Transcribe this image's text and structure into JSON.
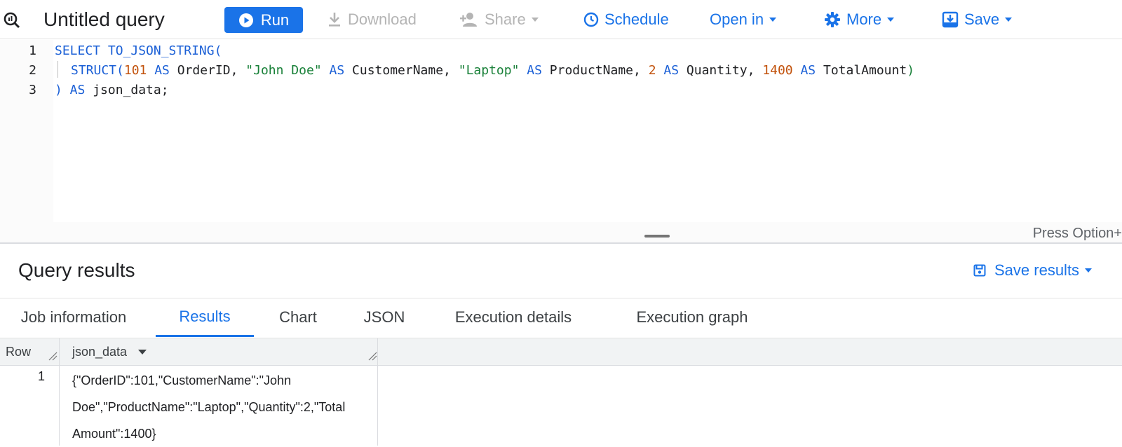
{
  "toolbar": {
    "title": "Untitled query",
    "run_label": "Run",
    "download_label": "Download",
    "share_label": "Share",
    "schedule_label": "Schedule",
    "open_in_label": "Open in",
    "more_label": "More",
    "save_label": "Save"
  },
  "editor": {
    "line_numbers": [
      "1",
      "2",
      "3"
    ],
    "lines": [
      [
        {
          "t": "SELECT TO_JSON_STRING(",
          "c": "kw"
        }
      ],
      [
        {
          "t": "STRUCT(",
          "c": "kw"
        },
        {
          "t": "101",
          "c": "num"
        },
        {
          "t": " AS ",
          "c": "kw"
        },
        {
          "t": "OrderID, ",
          "c": ""
        },
        {
          "t": "\"John Doe\"",
          "c": "str"
        },
        {
          "t": " AS ",
          "c": "kw"
        },
        {
          "t": "CustomerName, ",
          "c": ""
        },
        {
          "t": "\"Laptop\"",
          "c": "str"
        },
        {
          "t": " AS ",
          "c": "kw"
        },
        {
          "t": "ProductName, ",
          "c": ""
        },
        {
          "t": "2",
          "c": "num"
        },
        {
          "t": " AS ",
          "c": "kw"
        },
        {
          "t": "Quantity, ",
          "c": ""
        },
        {
          "t": "1400",
          "c": "num"
        },
        {
          "t": " AS ",
          "c": "kw"
        },
        {
          "t": "TotalAmount",
          "c": ""
        },
        {
          "t": ")",
          "c": "str"
        }
      ],
      [
        {
          "t": ") AS ",
          "c": "kw"
        },
        {
          "t": "json_data;",
          "c": ""
        }
      ]
    ],
    "hint": "Press Option+"
  },
  "results": {
    "title": "Query results",
    "save_results_label": "Save results",
    "tabs": [
      "Job information",
      "Results",
      "Chart",
      "JSON",
      "Execution details",
      "Execution graph"
    ],
    "active_tab": "Results",
    "columns": [
      "Row",
      "json_data"
    ],
    "rows": [
      {
        "row": "1",
        "json_data_lines": [
          "{\"OrderID\":101,\"CustomerName\":\"John",
          "Doe\",\"ProductName\":\"Laptop\",\"Quantity\":2,\"Total",
          "Amount\":1400}"
        ]
      }
    ]
  },
  "colors": {
    "accent": "#1a73e8",
    "keyword": "#1a5fd6",
    "string": "#188038",
    "number": "#c2520c"
  }
}
